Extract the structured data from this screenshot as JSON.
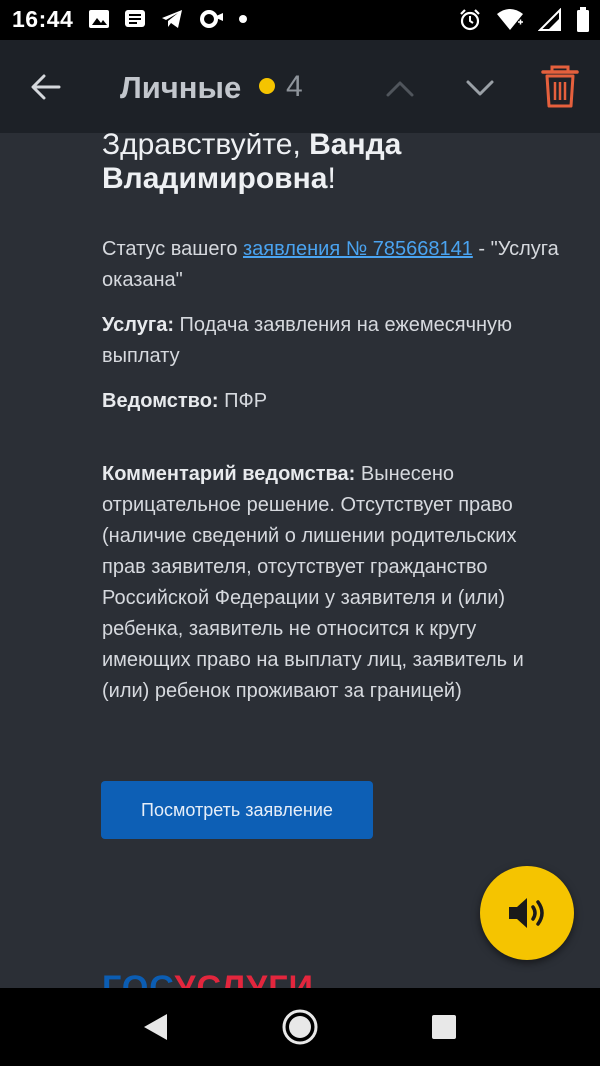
{
  "status_bar": {
    "time": "16:44",
    "left_icons": [
      "image-icon",
      "message-icon",
      "telegram-icon",
      "link-icon",
      "dot-icon"
    ],
    "right_icons": [
      "alarm-icon",
      "wifi-icon",
      "signal-icon",
      "battery-icon"
    ]
  },
  "app_bar": {
    "folder_title": "Личные",
    "unread_count": "4",
    "colors": {
      "background": "#1d2127",
      "dot": "#f5c400",
      "trash": "#e5603d"
    }
  },
  "email": {
    "greeting_prefix": "Здравствуйте, ",
    "greeting_name": "Ванда Владимировна",
    "greeting_suffix": "!",
    "status_prefix": "Статус вашего ",
    "status_link": "заявления № 785668141",
    "status_suffix": " - \"Услуга оказана\"",
    "service_label": "Услуга:",
    "service_value": " Подача заявления на ежемесячную выплату",
    "agency_label": "Ведомство:",
    "agency_value": " ПФР",
    "comment_label": "Комментарий ведомства:",
    "comment_value": " Вынесено отрицательное решение. Отсутствует право (наличие сведений о лишении родительских прав заявителя, отсутствует гражданство Российской Федерации у заявителя и (или) ребенка, заявитель не относится к кругу имеющих право на выплату лиц, заявитель и (или) ребенок проживают за границей)",
    "view_button": "Посмотреть заявление",
    "logo_part1": "ГОС",
    "logo_part2": "УСЛУГИ"
  },
  "fab": {
    "icon": "speaker-icon",
    "color": "#f5c400"
  },
  "nav_bar": {
    "icons": [
      "back-triangle-icon",
      "home-circle-icon",
      "recents-square-icon"
    ]
  }
}
